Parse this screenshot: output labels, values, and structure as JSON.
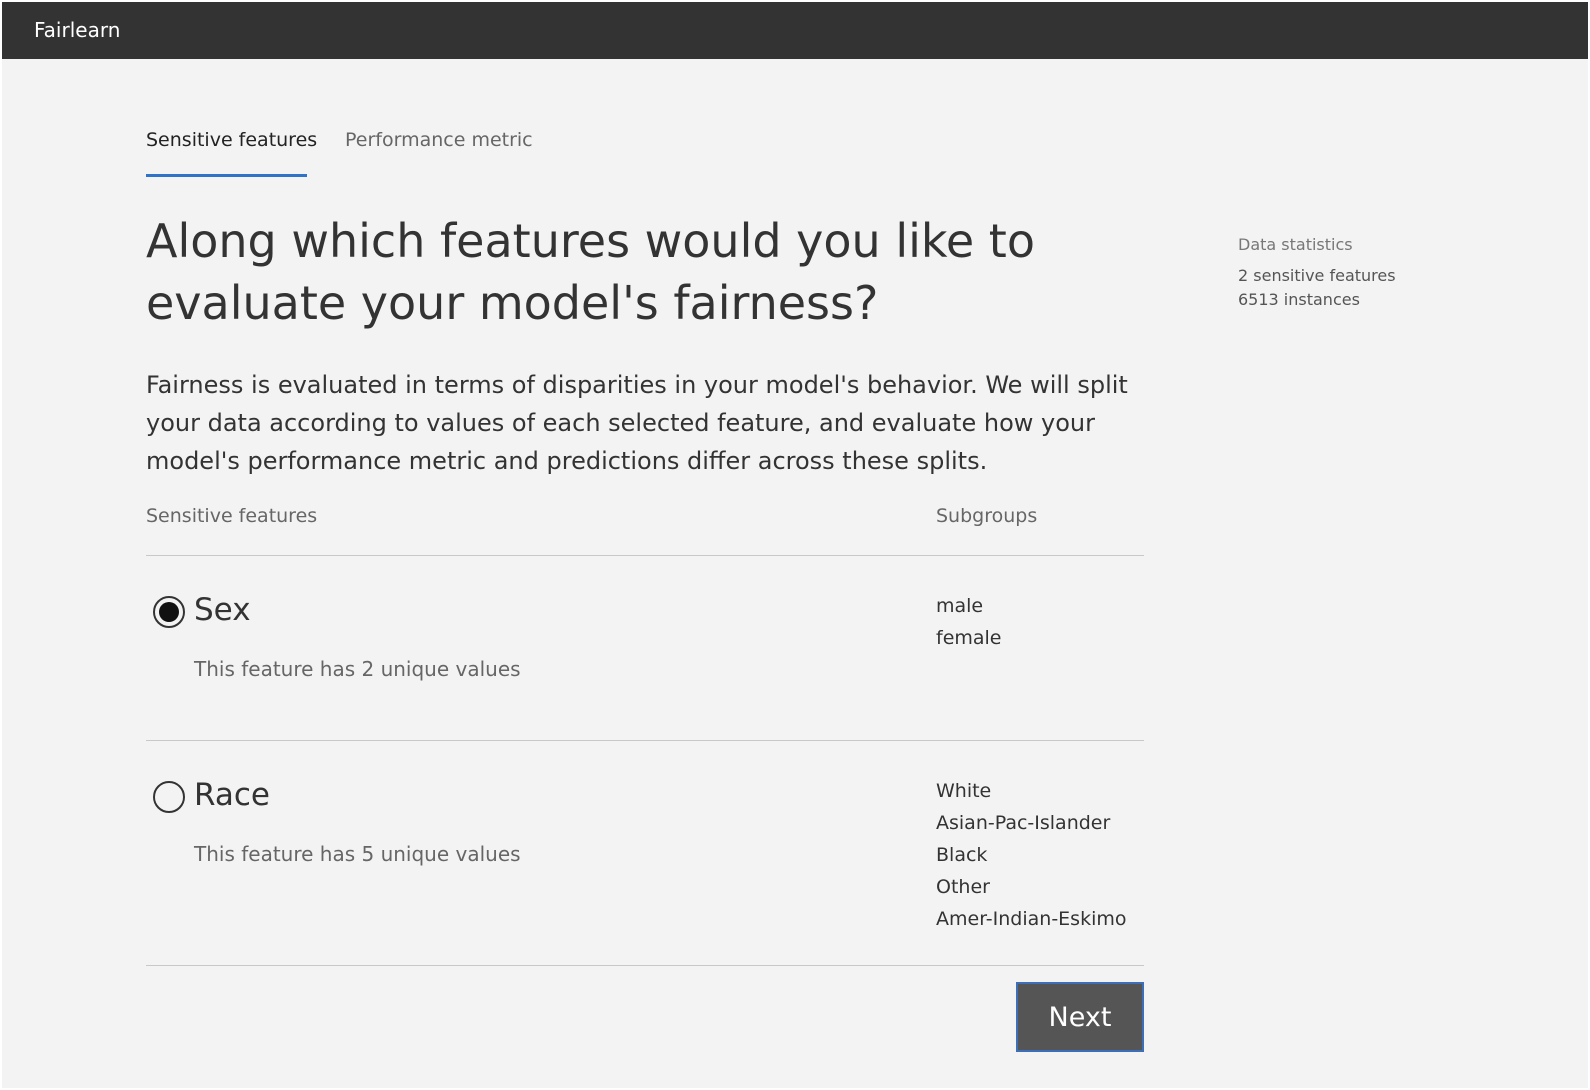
{
  "app": {
    "title": "Fairlearn"
  },
  "tabs": [
    {
      "label": "Sensitive features",
      "active": true
    },
    {
      "label": "Performance metric",
      "active": false
    }
  ],
  "main": {
    "headline": "Along which features would you like to evaluate your model's fairness?",
    "description": "Fairness is evaluated in terms of disparities in your model's behavior. We will split your data according to values of each selected feature, and evaluate how your model's performance metric and predictions differ across these splits.",
    "columns": {
      "features": "Sensitive features",
      "subgroups": "Subgroups"
    },
    "features": [
      {
        "name": "Sex",
        "description": "This feature has 2 unique values",
        "selected": true,
        "subgroups": [
          "male",
          "female"
        ]
      },
      {
        "name": "Race",
        "description": "This feature has 5 unique values",
        "selected": false,
        "subgroups": [
          "White",
          "Asian-Pac-Islander",
          "Black",
          "Other",
          "Amer-Indian-Eskimo"
        ]
      }
    ],
    "next_label": "Next"
  },
  "stats": {
    "title": "Data statistics",
    "features_line": "2 sensitive features",
    "instances_line": "6513 instances"
  },
  "colors": {
    "topbar": "#333333",
    "background": "#f3f3f3",
    "accent": "#2f73c9",
    "button": "#555555"
  }
}
